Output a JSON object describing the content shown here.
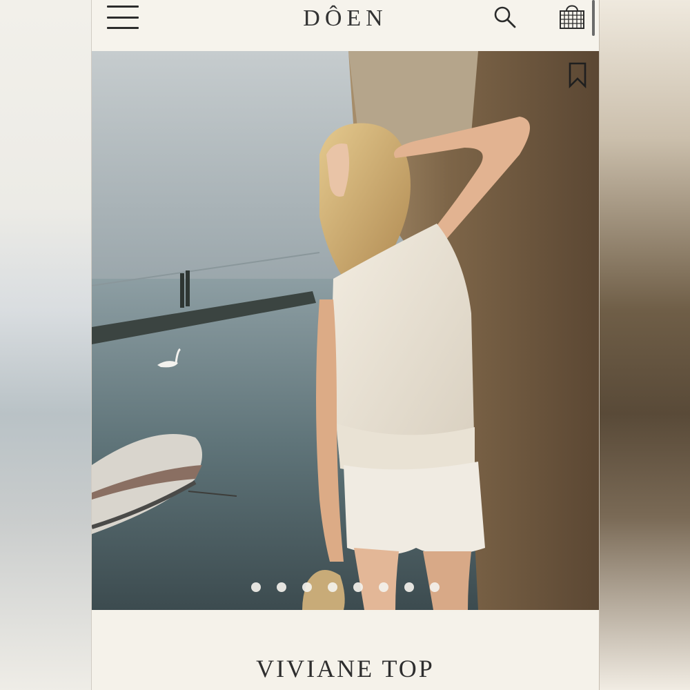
{
  "header": {
    "brand": "DÔEN",
    "icons": [
      "menu-icon",
      "search-icon",
      "shopping-bag-icon"
    ]
  },
  "hero": {
    "bookmark_icon": "bookmark-icon",
    "carousel": {
      "total_slides": 8,
      "active_index": 0
    }
  },
  "product": {
    "title": "VIVIANE TOP"
  },
  "colors": {
    "page_background": "#f5f2ea",
    "text": "#2e2e2e"
  }
}
